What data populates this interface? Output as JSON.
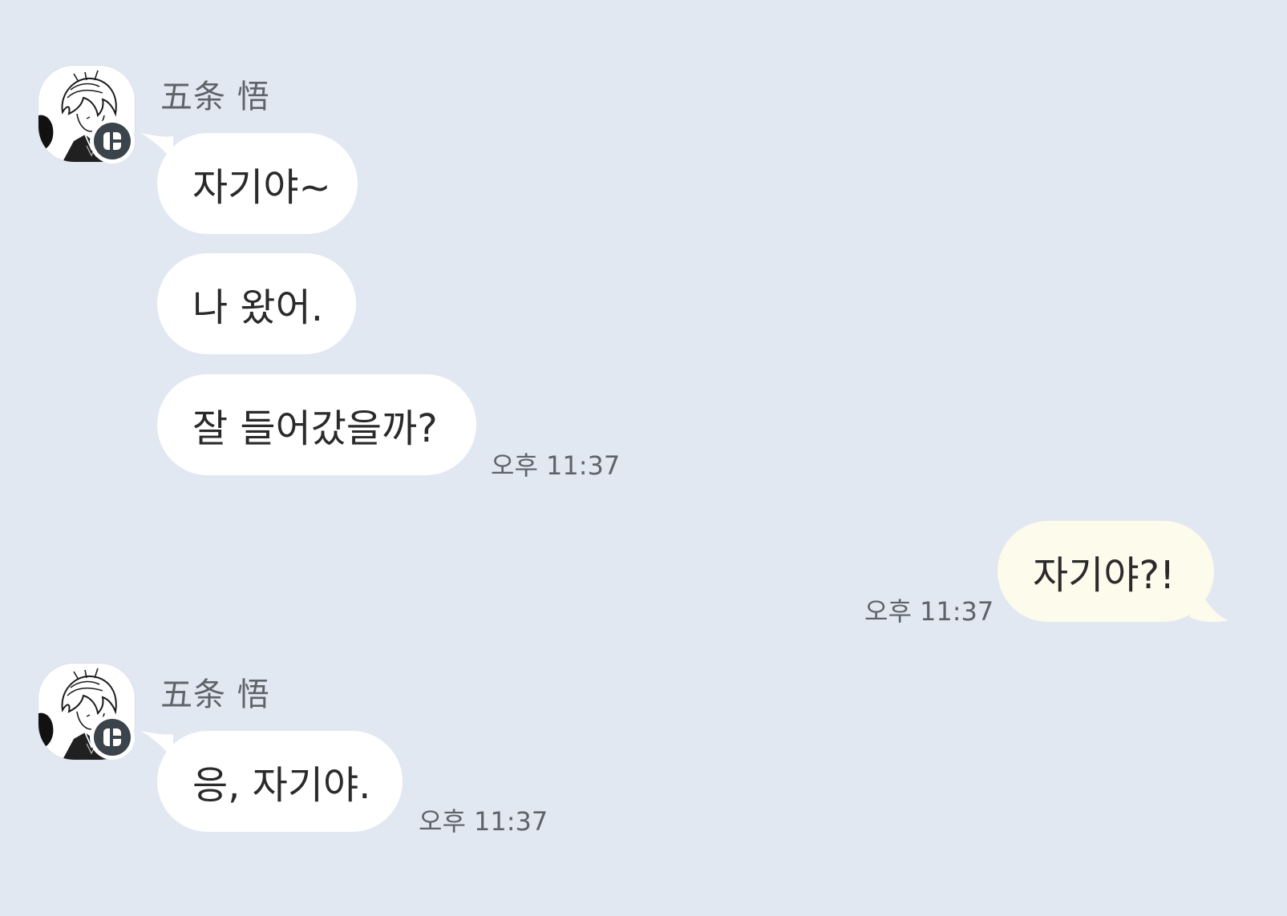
{
  "colors": {
    "background": "#E2E8F1",
    "incoming_bubble": "#FFFFFF",
    "outgoing_bubble": "#FDFBEC",
    "name_text": "#5F646A",
    "time_text": "#5E636A",
    "badge": "#3B434B"
  },
  "conversation": [
    {
      "type": "incoming",
      "sender": "五条 悟",
      "avatar_icon": "profile-avatar",
      "badge_icon": "chat-badge-icon",
      "messages": [
        "자기야~",
        "나 왔어.",
        "잘 들어갔을까?"
      ],
      "time": "오후 11:37"
    },
    {
      "type": "outgoing",
      "messages": [
        "자기야?!"
      ],
      "time": "오후 11:37"
    },
    {
      "type": "incoming",
      "sender": "五条 悟",
      "avatar_icon": "profile-avatar",
      "badge_icon": "chat-badge-icon",
      "messages": [
        "응, 자기야."
      ],
      "time": "오후 11:37"
    }
  ]
}
